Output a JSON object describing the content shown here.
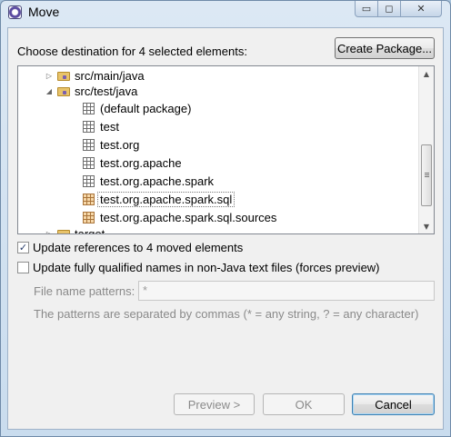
{
  "window": {
    "title": "Move",
    "controls": {
      "minimize": "▭",
      "maximize": "◻",
      "close": "✕"
    }
  },
  "dialog": {
    "prompt": "Choose destination for 4 selected elements:",
    "create_package_label": "Create Package..."
  },
  "tree": {
    "items": [
      {
        "label": "src/main/java",
        "kind": "source-folder",
        "expanded": false
      },
      {
        "label": "src/test/java",
        "kind": "source-folder",
        "expanded": true
      },
      {
        "label": "(default package)",
        "kind": "package"
      },
      {
        "label": "test",
        "kind": "package"
      },
      {
        "label": "test.org",
        "kind": "package"
      },
      {
        "label": "test.org.apache",
        "kind": "package"
      },
      {
        "label": "test.org.apache.spark",
        "kind": "package"
      },
      {
        "label": "test.org.apache.spark.sql",
        "kind": "package",
        "selected": true
      },
      {
        "label": "test.org.apache.spark.sql.sources",
        "kind": "package"
      },
      {
        "label": "target",
        "kind": "folder",
        "expanded": false
      }
    ]
  },
  "options": {
    "update_references": {
      "label": "Update references to 4 moved elements",
      "checked": true
    },
    "update_qualified_names": {
      "label": "Update fully qualified names in non-Java text files (forces preview)",
      "checked": false
    },
    "file_name_patterns": {
      "label": "File name patterns:",
      "value": "*",
      "hint": "The patterns are separated by commas (* = any string, ? = any character)"
    }
  },
  "buttons": {
    "preview": "Preview >",
    "ok": "OK",
    "cancel": "Cancel"
  },
  "colors": {
    "selection_border": "#7a7a7a",
    "default_button_border": "#3c7fb1"
  }
}
